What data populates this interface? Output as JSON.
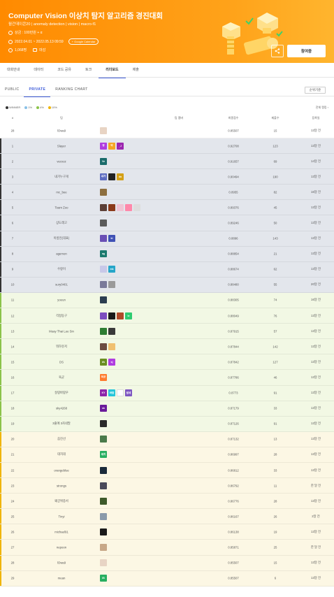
{
  "header": {
    "title": "Computer Vision 이상치 탐지 알고리즘 경진대회",
    "subtitle": "월간데이콘20 | anomaly detection | vision | macro-f1",
    "prize": "상금 : 100만원 + α",
    "period": "2022.04.01 ~ 2022.05.13 09:59",
    "calendar_label": "+ Google Calendar",
    "participants": "1,068명",
    "status": "마감",
    "join_label": "참여중",
    "share_icon": "share-icon"
  },
  "main_tabs": [
    "대회안내",
    "데이터",
    "코드 공유",
    "토크",
    "리더보드",
    "제출"
  ],
  "sub_tabs": [
    "PUBLIC",
    "PRIVATE",
    "RANKING CHART"
  ],
  "sort_label": "순위기준",
  "legend": [
    {
      "label": "WINNER",
      "color": "#333333"
    },
    {
      "label": "1%",
      "color": "#88c0e6"
    },
    {
      "label": "4%",
      "color": "#8bc34a"
    },
    {
      "label": "10%",
      "color": "#f0b400"
    }
  ],
  "all_rank_label": "전체 랭킹 ›",
  "columns": [
    "#",
    "팀",
    "팀 멤버",
    "최종점수",
    "제출수",
    "등록일"
  ],
  "rows": [
    {
      "rank": "28",
      "team": "lOwa9",
      "score": "0.85507",
      "submits": "15",
      "date": "13달 전",
      "tier": "mine",
      "avatars": [
        {
          "label": "",
          "color": "#e8d4c4"
        }
      ]
    },
    {
      "rank": "1",
      "team": "Slayer",
      "score": "0.92708",
      "submits": "123",
      "date": "13달 전",
      "tier": "winner",
      "avatars": [
        {
          "label": "정",
          "color": "#b03de0"
        },
        {
          "label": "박",
          "color": "#f5a623"
        },
        {
          "label": "_J",
          "color": "#9c27b0"
        }
      ]
    },
    {
      "rank": "2",
      "team": "vecxoz",
      "score": "0.91657",
      "submits": "69",
      "date": "14달 전",
      "tier": "winner",
      "avatars": [
        {
          "label": "Ve",
          "color": "#1a6b6b"
        }
      ]
    },
    {
      "rank": "3",
      "team": "내가누구게",
      "score": "0.90494",
      "submits": "190",
      "date": "13달 전",
      "tier": "winner",
      "avatars": [
        {
          "label": "내가",
          "color": "#5c6bc0"
        },
        {
          "label": "",
          "color": "#222222"
        },
        {
          "label": "da",
          "color": "#d4a017"
        }
      ]
    },
    {
      "rank": "4",
      "team": "mc_bee",
      "score": "0.8955",
      "submits": "82",
      "date": "16달 전",
      "tier": "winner",
      "avatars": [
        {
          "label": "",
          "color": "#8d6e3f"
        }
      ]
    },
    {
      "rank": "5",
      "team": "Team Zoo",
      "score": "0.89376",
      "submits": "45",
      "date": "13달 전",
      "tier": "winner",
      "avatars": [
        {
          "label": "",
          "color": "#5d4037"
        },
        {
          "label": "",
          "color": "#8b3a1a"
        },
        {
          "label": "",
          "color": "#f0c4d4"
        },
        {
          "label": "",
          "color": "#ff88aa"
        },
        {
          "label": "",
          "color": "#dddddd"
        }
      ]
    },
    {
      "rank": "6",
      "team": "상도레고",
      "score": "0.89246",
      "submits": "50",
      "date": "13달 전",
      "tier": "winner",
      "avatars": [
        {
          "label": "",
          "color": "#5a5a5a"
        }
      ]
    },
    {
      "rank": "7",
      "team": "이방인(대표)",
      "score": "0.8896",
      "submits": "143",
      "date": "13달 전",
      "tier": "winner",
      "avatars": [
        {
          "label": "",
          "color": "#6a4fb5"
        },
        {
          "label": "ki",
          "color": "#3f51b5"
        }
      ]
    },
    {
      "rank": "8",
      "team": "agemon",
      "score": "0.88854",
      "submits": "21",
      "date": "13달 전",
      "tier": "winner",
      "avatars": [
        {
          "label": "ag",
          "color": "#1b7a6e"
        }
      ]
    },
    {
      "rank": "9",
      "team": "수랑이",
      "score": "0.88674",
      "submits": "62",
      "date": "13달 전",
      "tier": "winner",
      "avatars": [
        {
          "label": "",
          "color": "#c8c8e8"
        },
        {
          "label": "mk",
          "color": "#26a6c9"
        }
      ]
    },
    {
      "rank": "10",
      "team": "sury0401",
      "score": "0.88480",
      "submits": "55",
      "date": "20달 전",
      "tier": "winner",
      "avatars": [
        {
          "label": "",
          "color": "#7a7a9a"
        },
        {
          "label": "",
          "color": "#9a9a9a"
        }
      ]
    },
    {
      "rank": "11",
      "team": "yoeun",
      "score": "0.88305",
      "submits": "74",
      "date": "16달 전",
      "tier": "silver",
      "avatars": [
        {
          "label": "",
          "color": "#2c3e50"
        }
      ]
    },
    {
      "rank": "12",
      "team": "걱정동구",
      "score": "0.88049",
      "submits": "76",
      "date": "13달 전",
      "tier": "silver",
      "avatars": [
        {
          "label": "",
          "color": "#7c4dbf"
        },
        {
          "label": "",
          "color": "#1a1a1a"
        },
        {
          "label": "",
          "color": "#b04a2a"
        },
        {
          "label": "le",
          "color": "#2ecc71"
        }
      ]
    },
    {
      "rank": "13",
      "team": "Muay Thai Lee Sin",
      "score": "0.87915",
      "submits": "57",
      "date": "13달 전",
      "tier": "silver",
      "avatars": [
        {
          "label": "",
          "color": "#2e7d32"
        },
        {
          "label": "",
          "color": "#3a3a3a"
        }
      ]
    },
    {
      "rank": "14",
      "team": "뭐하유저",
      "score": "0.87844",
      "submits": "142",
      "date": "13달 전",
      "tier": "silver",
      "avatars": [
        {
          "label": "",
          "color": "#6d4c41"
        },
        {
          "label": "",
          "color": "#f0c070"
        }
      ]
    },
    {
      "rank": "15",
      "team": "DS",
      "score": "0.87842",
      "submits": "127",
      "date": "13달 전",
      "tier": "silver",
      "avatars": [
        {
          "label": "ds",
          "color": "#6b8e23"
        },
        {
          "label": "sj",
          "color": "#b03de0"
        }
      ]
    },
    {
      "rank": "16",
      "team": "육균",
      "score": "0.87786",
      "submits": "46",
      "date": "13달 전",
      "tier": "silver",
      "avatars": [
        {
          "label": "육균",
          "color": "#ff7b2e"
        }
      ]
    },
    {
      "rank": "17",
      "team": "살랑바람우",
      "score": "0.8773",
      "submits": "91",
      "date": "13달 전",
      "tier": "silver",
      "avatars": [
        {
          "label": "KY",
          "color": "#8e24aa"
        },
        {
          "label": "바람",
          "color": "#26c6da"
        },
        {
          "label": "",
          "color": "#ffffff"
        },
        {
          "label": "발세",
          "color": "#7e57c2"
        }
      ]
    },
    {
      "rank": "18",
      "team": "sky4268",
      "score": "0.87179",
      "submits": "33",
      "date": "13달 전",
      "tier": "silver",
      "avatars": [
        {
          "label": "sk",
          "color": "#6a1b9a"
        }
      ]
    },
    {
      "rank": "19",
      "team": "3줄에 3자네말",
      "score": "0.87126",
      "submits": "91",
      "date": "13달 전",
      "tier": "silver",
      "avatars": [
        {
          "label": "",
          "color": "#2a2a2a"
        }
      ]
    },
    {
      "rank": "20",
      "team": "음진선",
      "score": "0.87132",
      "submits": "13",
      "date": "13달 전",
      "tier": "gold",
      "avatars": [
        {
          "label": "",
          "color": "#4a7a4a"
        }
      ]
    },
    {
      "rank": "21",
      "team": "데치데",
      "score": "0.86997",
      "submits": "28",
      "date": "13달 전",
      "tier": "gold",
      "avatars": [
        {
          "label": "데치",
          "color": "#27ae60"
        }
      ]
    },
    {
      "rank": "22",
      "team": "orangeblue",
      "score": "0.86812",
      "submits": "33",
      "date": "13달 전",
      "tier": "gold",
      "avatars": [
        {
          "label": "",
          "color": "#1a2a3a"
        }
      ]
    },
    {
      "rank": "23",
      "team": "strongs",
      "score": "0.86792",
      "submits": "11",
      "date": "한 달 전",
      "tier": "gold",
      "avatars": [
        {
          "label": "",
          "color": "#4a4a5a"
        }
      ]
    },
    {
      "rank": "24",
      "team": "왜궁위중서",
      "score": "0.86776",
      "submits": "28",
      "date": "13달 전",
      "tier": "gold",
      "avatars": [
        {
          "label": "",
          "color": "#3d5a2a"
        }
      ]
    },
    {
      "rank": "25",
      "team": "Tinyi",
      "score": "0.86167",
      "submits": "26",
      "date": "2달 전",
      "tier": "gold",
      "avatars": [
        {
          "label": "",
          "color": "#8a9aaa"
        }
      ]
    },
    {
      "rank": "26",
      "team": "michael91",
      "score": "0.86138",
      "submits": "19",
      "date": "13달 전",
      "tier": "gold",
      "avatars": [
        {
          "label": "",
          "color": "#1a1a1a"
        }
      ]
    },
    {
      "rank": "27",
      "team": "nepoon",
      "score": "0.85871",
      "submits": "25",
      "date": "한 달 전",
      "tier": "gold",
      "avatars": [
        {
          "label": "",
          "color": "#c8a888"
        }
      ]
    },
    {
      "rank": "28",
      "team": "lOwa9",
      "score": "0.85507",
      "submits": "15",
      "date": "13달 전",
      "tier": "gold",
      "avatars": [
        {
          "label": "",
          "color": "#e8d4c4"
        }
      ]
    },
    {
      "rank": "29",
      "team": "mean",
      "score": "0.85507",
      "submits": "6",
      "date": "13달 전",
      "tier": "gold",
      "avatars": [
        {
          "label": "IB",
          "color": "#27ae60"
        }
      ]
    }
  ],
  "tier_bar_colors": {
    "winner": "#333333",
    "silver": "#8bc34a",
    "gold": "#f0b400",
    "mine": "#ffffff"
  }
}
